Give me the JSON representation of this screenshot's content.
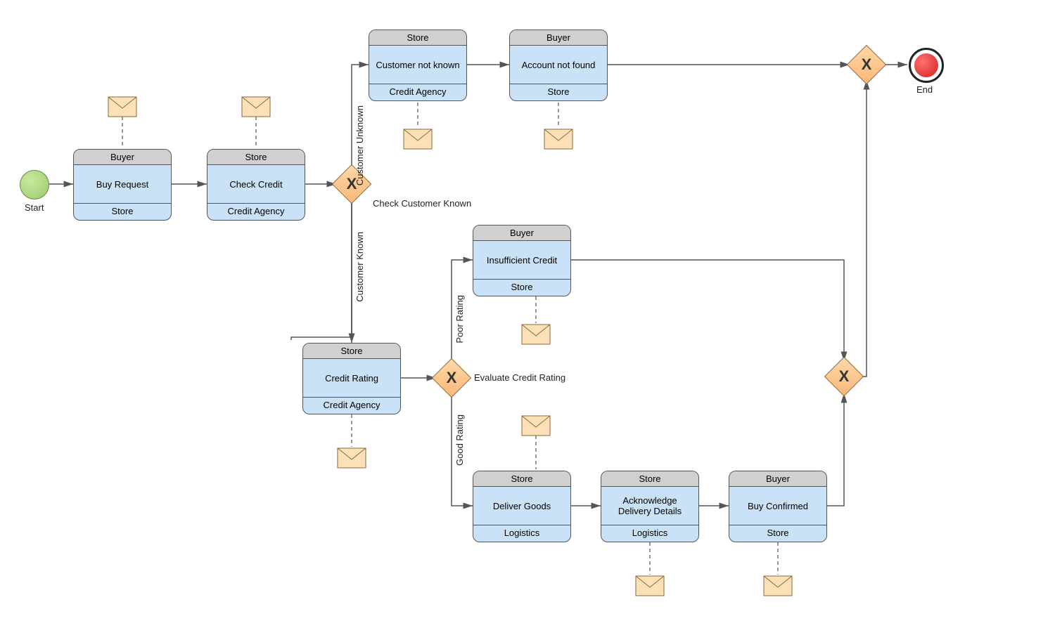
{
  "events": {
    "start_label": "Start",
    "end_label": "End"
  },
  "gateways": {
    "check_customer": "Check Customer Known",
    "evaluate_credit": "Evaluate Credit Rating"
  },
  "edges": {
    "customer_unknown": "Customer Unknown",
    "customer_known": "Customer Known",
    "poor_rating": "Poor Rating",
    "good_rating": "Good Rating"
  },
  "tasks": {
    "buy_request": {
      "top": "Buyer",
      "mid": "Buy Request",
      "bot": "Store"
    },
    "check_credit": {
      "top": "Store",
      "mid": "Check Credit",
      "bot": "Credit Agency"
    },
    "customer_not_known": {
      "top": "Store",
      "mid": "Customer not known",
      "bot": "Credit Agency"
    },
    "account_not_found": {
      "top": "Buyer",
      "mid": "Account not found",
      "bot": "Store"
    },
    "credit_rating": {
      "top": "Store",
      "mid": "Credit Rating",
      "bot": "Credit Agency"
    },
    "insufficient_credit": {
      "top": "Buyer",
      "mid": "Insufficient Credit",
      "bot": "Store"
    },
    "deliver_goods": {
      "top": "Store",
      "mid": "Deliver Goods",
      "bot": "Logistics"
    },
    "ack_delivery": {
      "top": "Store",
      "mid": "Acknowledge Delivery Details",
      "bot": "Logistics"
    },
    "buy_confirmed": {
      "top": "Buyer",
      "mid": "Buy Confirmed",
      "bot": "Store"
    }
  }
}
